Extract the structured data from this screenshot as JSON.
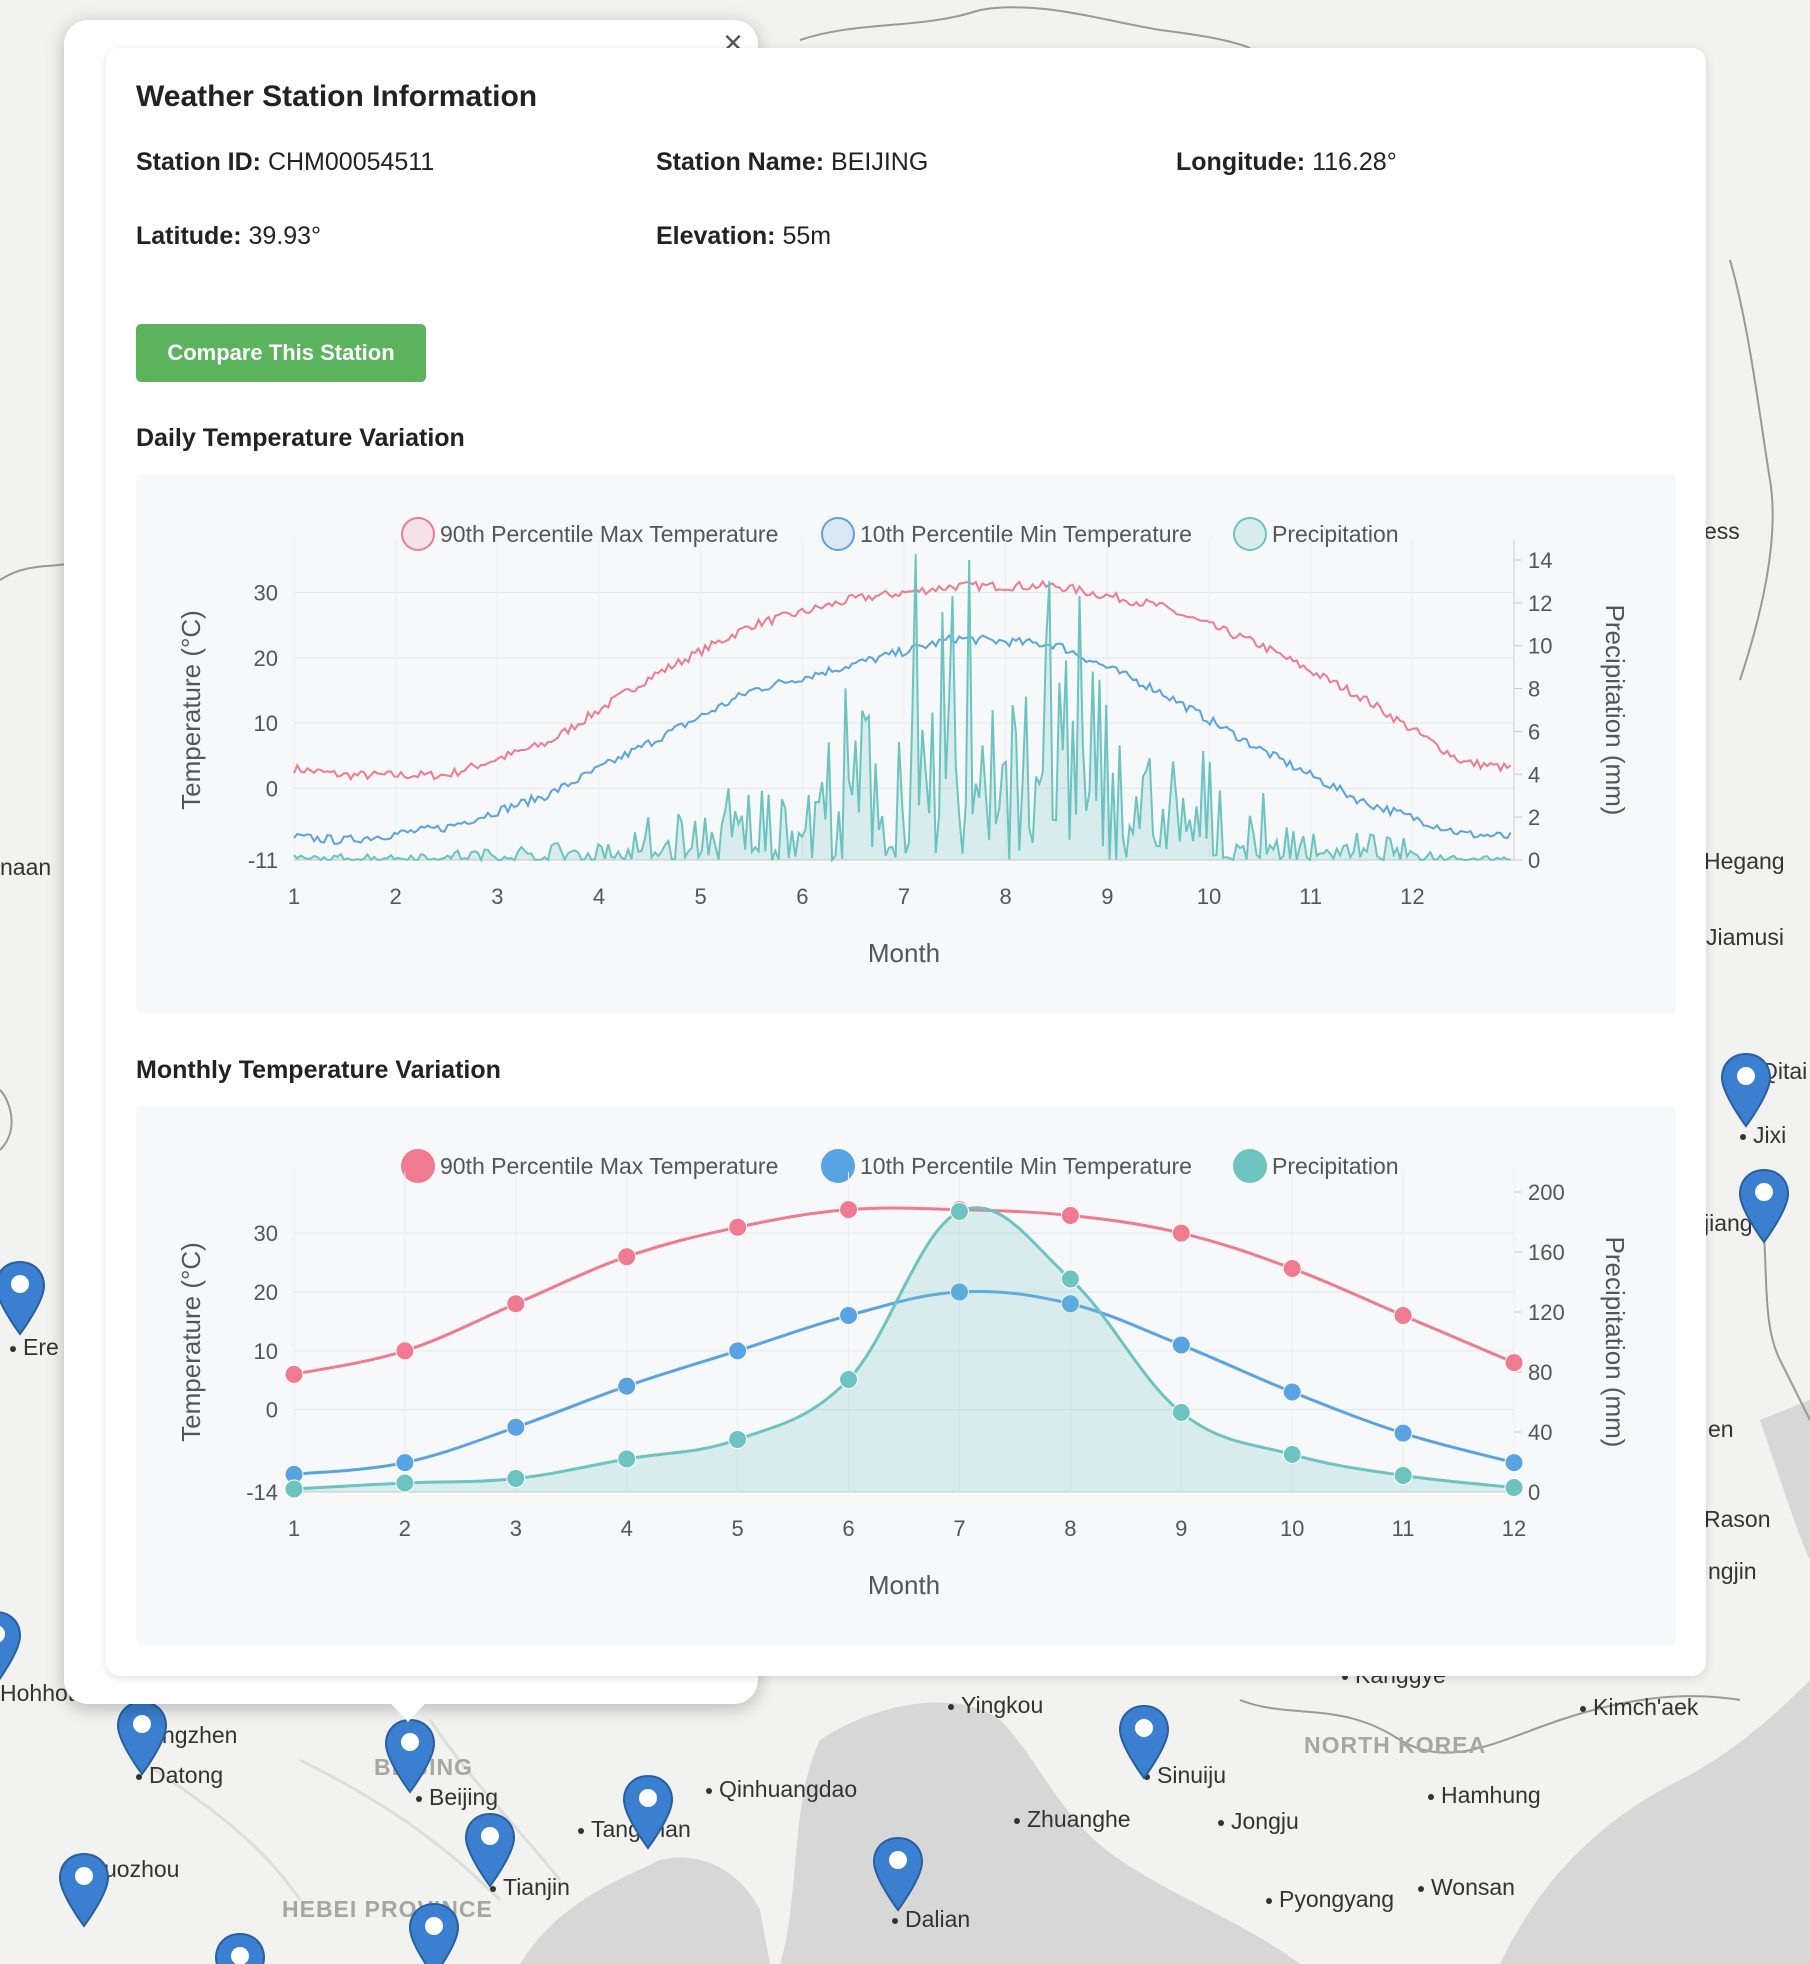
{
  "map": {
    "labels": [
      {
        "text": "Hohhot",
        "dot": false,
        "region": false
      },
      {
        "text": "Datong",
        "dot": true,
        "region": false
      },
      {
        "text": "ngzhen",
        "dot": false,
        "region": false
      },
      {
        "text": "uozhou",
        "dot": false,
        "region": false
      },
      {
        "text": "BEIJING",
        "dot": false,
        "region": true
      },
      {
        "text": "Beijing",
        "dot": true,
        "region": false
      },
      {
        "text": "Tianjin",
        "dot": true,
        "region": false
      },
      {
        "text": "Tangshan",
        "dot": true,
        "region": false
      },
      {
        "text": "Qinhuangdao",
        "dot": true,
        "region": false
      },
      {
        "text": "HEBEI PROVINCE",
        "dot": false,
        "region": true
      },
      {
        "text": "Dalian",
        "dot": true,
        "region": false
      },
      {
        "text": "Yingkou",
        "dot": true,
        "region": false
      },
      {
        "text": "Zhuanghe",
        "dot": true,
        "region": false
      },
      {
        "text": "Sinuiju",
        "dot": true,
        "region": false
      },
      {
        "text": "Jongju",
        "dot": true,
        "region": false
      },
      {
        "text": "NORTH KOREA",
        "dot": false,
        "region": true
      },
      {
        "text": "Pyongyang",
        "dot": true,
        "region": false
      },
      {
        "text": "Hamhung",
        "dot": true,
        "region": false
      },
      {
        "text": "Wonsan",
        "dot": true,
        "region": false
      },
      {
        "text": "Kimch'aek",
        "dot": true,
        "region": false
      },
      {
        "text": "Kanggye",
        "dot": true,
        "region": false
      },
      {
        "text": "Rason",
        "dot": false,
        "region": false
      },
      {
        "text": "ngjin",
        "dot": false,
        "region": false
      },
      {
        "text": "en",
        "dot": false,
        "region": false
      },
      {
        "text": "jiang",
        "dot": false,
        "region": false
      },
      {
        "text": "Jixi",
        "dot": true,
        "region": false
      },
      {
        "text": "Qitai",
        "dot": false,
        "region": false
      },
      {
        "text": "Jiamusi",
        "dot": false,
        "region": false
      },
      {
        "text": "Hegang",
        "dot": false,
        "region": false
      },
      {
        "text": "ess",
        "dot": false,
        "region": false
      },
      {
        "text": "naan",
        "dot": false,
        "region": false
      },
      {
        "text": "Ere",
        "dot": true,
        "region": false
      }
    ],
    "marker_color": "#3a7fd0"
  },
  "popup": {
    "close_label": "×"
  },
  "station": {
    "title": "Weather Station Information",
    "id_label": "Station ID:",
    "id_value": "CHM00054511",
    "name_label": "Station Name:",
    "name_value": "BEIJING",
    "lon_label": "Longitude:",
    "lon_value": "116.28°",
    "lat_label": "Latitude:",
    "lat_value": "39.93°",
    "elev_label": "Elevation:",
    "elev_value": "55m",
    "compare_label": "Compare This Station"
  },
  "colors": {
    "max": "#f07a8f",
    "min": "#5aa3e3",
    "precip": "#6cc3bf",
    "button": "#5cb35e"
  },
  "daily_title": "Daily Temperature Variation",
  "monthly_title": "Monthly Temperature Variation",
  "chart_data": [
    {
      "type": "line",
      "title": "",
      "xlabel": "Month",
      "ylabel": "Temperature (°C)",
      "y2label": "Precipitation (mm)",
      "legend": [
        "90th Percentile Max Temperature",
        "10th Percentile Min Temperature",
        "Precipitation"
      ],
      "legend_position": "top",
      "x_ticks": [
        "1",
        "2",
        "3",
        "4",
        "5",
        "6",
        "7",
        "8",
        "9",
        "10",
        "11",
        "12"
      ],
      "y_ticks": [
        "-11",
        "0",
        "10",
        "20",
        "30"
      ],
      "y2_ticks": [
        "0",
        "2",
        "4",
        "6",
        "8",
        "10",
        "12",
        "14"
      ],
      "ylim": [
        -11,
        35
      ],
      "y2lim": [
        0,
        14
      ],
      "series": [
        {
          "name": "90th Percentile Max Temperature",
          "axis": "left",
          "values": [
            2,
            2,
            7,
            17,
            25,
            29,
            31,
            31,
            28,
            22,
            14,
            4
          ]
        },
        {
          "name": "10th Percentile Min Temperature",
          "axis": "left",
          "values": [
            -8,
            -6,
            -1,
            7,
            15,
            19,
            23,
            22,
            15,
            6,
            -2,
            -7
          ]
        },
        {
          "name": "Precipitation",
          "axis": "right",
          "values": [
            0.1,
            0.2,
            0.3,
            0.8,
            1.5,
            3.0,
            6.0,
            5.5,
            2.5,
            1.0,
            0.5,
            0.1
          ]
        }
      ]
    },
    {
      "type": "line",
      "title": "",
      "xlabel": "Month",
      "ylabel": "Temperature (°C)",
      "y2label": "Precipitation (mm)",
      "legend": [
        "90th Percentile Max Temperature",
        "10th Percentile Min Temperature",
        "Precipitation"
      ],
      "legend_position": "top",
      "categories": [
        "1",
        "2",
        "3",
        "4",
        "5",
        "6",
        "7",
        "8",
        "9",
        "10",
        "11",
        "12"
      ],
      "y_ticks": [
        "-14",
        "0",
        "10",
        "20",
        "30"
      ],
      "y2_ticks": [
        "0",
        "40",
        "80",
        "120",
        "160",
        "200"
      ],
      "ylim": [
        -14,
        37
      ],
      "y2lim": [
        0,
        200
      ],
      "series": [
        {
          "name": "90th Percentile Max Temperature",
          "axis": "left",
          "values": [
            6,
            10,
            18,
            26,
            31,
            34,
            34,
            33,
            30,
            24,
            16,
            8
          ]
        },
        {
          "name": "10th Percentile Min Temperature",
          "axis": "left",
          "values": [
            -11,
            -9,
            -3,
            4,
            10,
            16,
            20,
            18,
            11,
            3,
            -4,
            -9
          ]
        },
        {
          "name": "Precipitation",
          "axis": "right",
          "values": [
            2,
            6,
            9,
            22,
            35,
            75,
            187,
            142,
            53,
            25,
            11,
            3
          ]
        }
      ]
    }
  ]
}
